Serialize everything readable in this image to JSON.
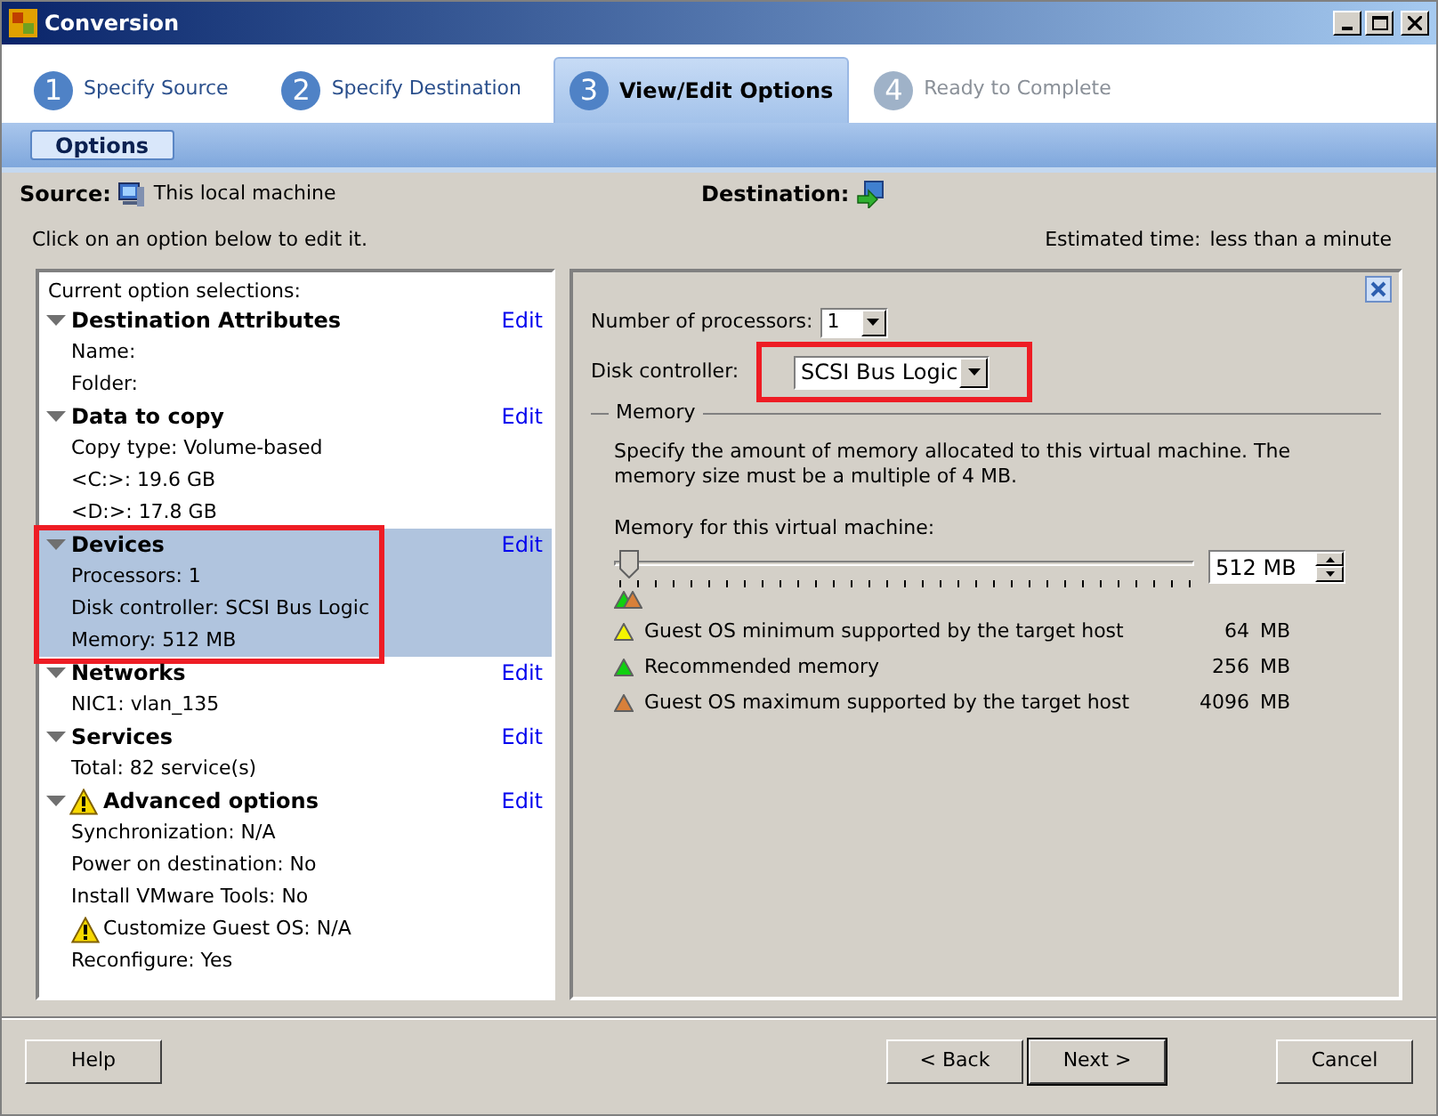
{
  "window": {
    "title": "Conversion"
  },
  "steps": [
    {
      "number": "1",
      "label": "Specify Source",
      "selected": false,
      "disabled": false
    },
    {
      "number": "2",
      "label": "Specify Destination",
      "selected": false,
      "disabled": false
    },
    {
      "number": "3",
      "label": "View/Edit Options",
      "selected": true,
      "disabled": false
    },
    {
      "number": "4",
      "label": "Ready to Complete",
      "selected": false,
      "disabled": true
    }
  ],
  "subtabs": [
    {
      "label": "Options",
      "selected": true
    }
  ],
  "source": {
    "label": "Source:",
    "value": "This local machine"
  },
  "destination": {
    "label": "Destination:"
  },
  "hint": "Click on an option below to edit it.",
  "estimated_time": {
    "label": "Estimated time:",
    "value": "less than a minute"
  },
  "options_panel": {
    "heading": "Current option selections:",
    "sections": [
      {
        "title": "Destination Attributes",
        "expanded": true,
        "selected": false,
        "highlighted": false,
        "warning": false,
        "edit": "Edit",
        "children": [
          {
            "text": "Name:",
            "warning": false
          },
          {
            "text": "Folder:",
            "warning": false
          }
        ]
      },
      {
        "title": "Data to copy",
        "expanded": true,
        "selected": false,
        "highlighted": false,
        "warning": false,
        "edit": "Edit",
        "children": [
          {
            "text": "Copy type: Volume-based",
            "warning": false
          },
          {
            "text": "<C:>: 19.6 GB",
            "warning": false
          },
          {
            "text": "<D:>: 17.8 GB",
            "warning": false
          }
        ]
      },
      {
        "title": "Devices",
        "expanded": true,
        "selected": true,
        "highlighted": true,
        "warning": false,
        "edit": "Edit",
        "children": [
          {
            "text": "Processors: 1",
            "warning": false
          },
          {
            "text": "Disk controller: SCSI Bus Logic",
            "warning": false
          },
          {
            "text": "Memory: 512 MB",
            "warning": false
          }
        ]
      },
      {
        "title": "Networks",
        "expanded": true,
        "selected": false,
        "highlighted": false,
        "warning": false,
        "edit": "Edit",
        "children": [
          {
            "text": "NIC1: vlan_135",
            "warning": false
          }
        ]
      },
      {
        "title": "Services",
        "expanded": true,
        "selected": false,
        "highlighted": false,
        "warning": false,
        "edit": "Edit",
        "children": [
          {
            "text": "Total: 82 service(s)",
            "warning": false
          }
        ]
      },
      {
        "title": "Advanced options",
        "expanded": true,
        "selected": false,
        "highlighted": false,
        "warning": true,
        "edit": "Edit",
        "children": [
          {
            "text": "Synchronization: N/A",
            "warning": false
          },
          {
            "text": "Power on destination: No",
            "warning": false
          },
          {
            "text": "Install VMware Tools: No",
            "warning": false
          },
          {
            "text": "Customize Guest OS: N/A",
            "warning": true
          },
          {
            "text": "Reconfigure: Yes",
            "warning": false
          }
        ]
      }
    ]
  },
  "devices_panel": {
    "processors": {
      "label": "Number of processors:",
      "value": "1"
    },
    "disk_controller": {
      "label": "Disk controller:",
      "value": "SCSI Bus Logic",
      "highlighted": true
    },
    "memory": {
      "group_label": "Memory",
      "description": "Specify the amount of memory allocated to this virtual machine. The memory size must be a multiple of 4 MB.",
      "slider_label": "Memory for this virtual machine:",
      "level": 0.01,
      "value": "512 MB",
      "legend": [
        {
          "label": "Guest OS minimum supported by the target host",
          "amount": "64",
          "unit": "MB",
          "color": "#f5f500",
          "on_scale": false
        },
        {
          "label": "Recommended memory",
          "amount": "256",
          "unit": "MB",
          "color": "#10d010",
          "on_scale": true
        },
        {
          "label": "Guest OS maximum supported by the target host",
          "amount": "4096",
          "unit": "MB",
          "color": "#d8803a",
          "on_scale": true
        }
      ]
    }
  },
  "buttons": [
    {
      "label": "Help",
      "kind": "left",
      "default": false
    },
    {
      "label": "< Back",
      "kind": "nav",
      "default": false
    },
    {
      "label": "Next >",
      "kind": "nav",
      "default": true
    },
    {
      "label": "Cancel",
      "kind": "right",
      "default": false
    }
  ]
}
